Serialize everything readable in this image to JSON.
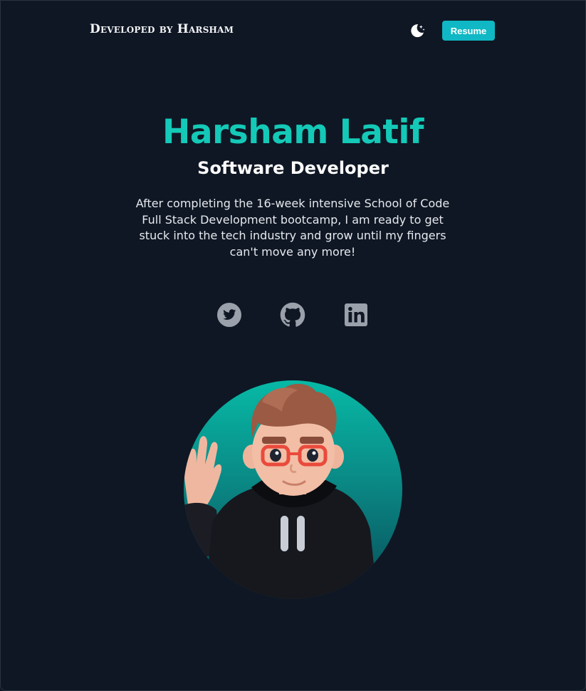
{
  "header": {
    "brand": "Developed by Harsham",
    "theme_toggle_icon": "moon-stars-icon",
    "resume_label": "Resume"
  },
  "hero": {
    "name": "Harsham Latif",
    "role": "Software Developer",
    "bio": "After completing the 16-week intensive School of Code Full Stack Development bootcamp, I am ready to get stuck into the tech industry and grow until my fingers can't move any more!"
  },
  "socials": [
    {
      "icon": "twitter-icon"
    },
    {
      "icon": "github-icon"
    },
    {
      "icon": "linkedin-icon"
    }
  ],
  "colors": {
    "background": "#0f1724",
    "accent": "#14c9b7",
    "button": "#0fb8c4",
    "social_icon": "#9aa1ab"
  }
}
